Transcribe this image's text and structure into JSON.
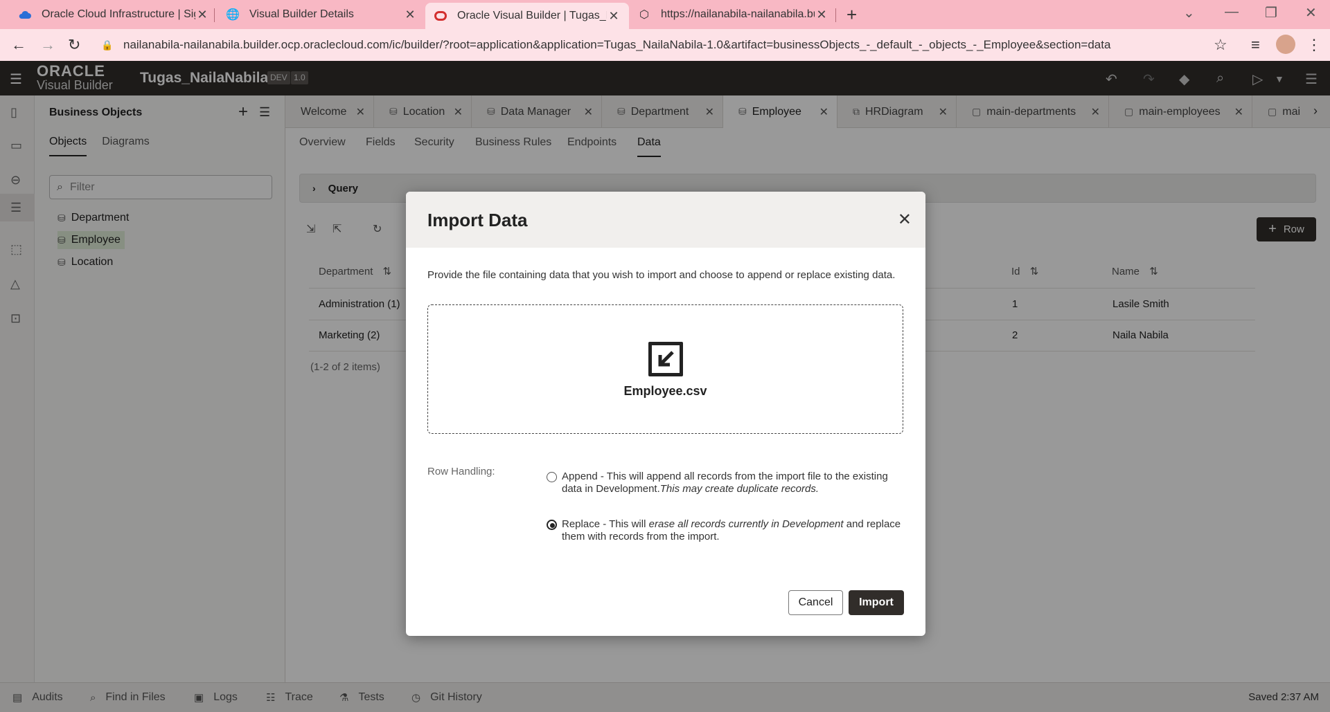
{
  "browser": {
    "tabs": [
      {
        "title": "Oracle Cloud Infrastructure | Sign"
      },
      {
        "title": "Visual Builder Details"
      },
      {
        "title": "Oracle Visual Builder | Tugas_Nai"
      },
      {
        "title": "https://nailanabila-nailanabila.bu"
      }
    ],
    "url": "nailanabila-nailanabila.builder.ocp.oraclecloud.com/ic/builder/?root=application&application=Tugas_NailaNabila-1.0&artifact=businessObjects_-_default_-_objects_-_Employee&section=data"
  },
  "app": {
    "logo_top": "ORACLE",
    "logo_bottom": "Visual Builder",
    "name": "Tugas_NailaNabila",
    "env_badge": "DEV",
    "version_badge": "1.0"
  },
  "business_objects": {
    "title": "Business Objects",
    "tabs": [
      "Objects",
      "Diagrams"
    ],
    "filter_placeholder": "Filter",
    "items": [
      "Department",
      "Employee",
      "Location"
    ]
  },
  "editor_tabs": [
    "Welcome",
    "Location",
    "Data Manager",
    "Department",
    "Employee",
    "HRDiagram",
    "main-departments",
    "main-employees",
    "mai"
  ],
  "sub_tabs": [
    "Overview",
    "Fields",
    "Security",
    "Business Rules",
    "Endpoints",
    "Data"
  ],
  "data_view": {
    "query_label": "Query",
    "row_button": "Row",
    "columns": {
      "department": "Department",
      "id": "Id",
      "name": "Name"
    },
    "rows": [
      {
        "department": "Administration (1)",
        "id": "1",
        "name": "Lasile Smith"
      },
      {
        "department": "Marketing (2)",
        "id": "2",
        "name": "Naila Nabila"
      }
    ],
    "pager": "(1-2 of 2 items)"
  },
  "dialog": {
    "title": "Import Data",
    "description": "Provide the file containing data that you wish to import and choose to append or replace existing data.",
    "file_name": "Employee.csv",
    "row_handling_label": "Row Handling:",
    "append_text": "Append - This will append all records from the import file to the existing data in Development.",
    "append_italic": "This may create duplicate records.",
    "replace_text_1": "Replace - This will ",
    "replace_italic": "erase all records currently in Development",
    "replace_text_2": " and replace them with records from the import.",
    "selected_option": "Replace",
    "cancel_label": "Cancel",
    "import_label": "Import"
  },
  "footer": {
    "items": [
      "Audits",
      "Find in Files",
      "Logs",
      "Trace",
      "Tests",
      "Git History"
    ],
    "status": "Saved 2:37 AM"
  },
  "colors": {
    "tab_strip": "#f8b8c4",
    "app_header": "#312d2a",
    "primary_button": "#312d2a"
  }
}
